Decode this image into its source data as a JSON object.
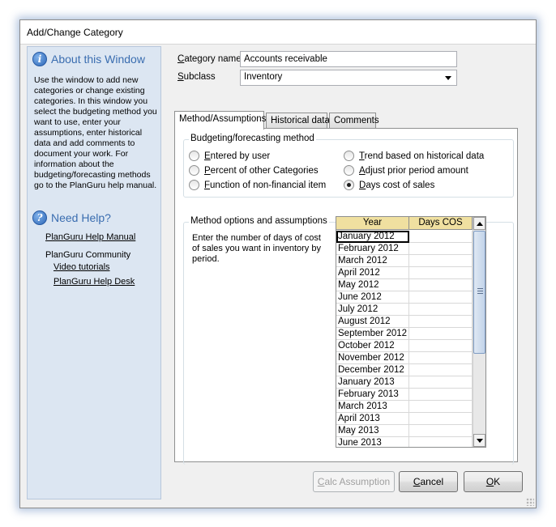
{
  "window": {
    "title": "Add/Change Category"
  },
  "side": {
    "about_heading": "About this Window",
    "about_body": "Use the window to add new categories or change existing categories.  In this window you select the budgeting method you want to use, enter your assumptions, enter historical data and add comments to document your work.  For information about the budgeting/forecasting methods go to the PlanGuru help manual.",
    "help_heading": "Need Help?",
    "help_manual_link": "PlanGuru Help Manual",
    "community_label": "PlanGuru Community",
    "video_link": "Video tutorials",
    "helpdesk_link": "PlanGuru Help Desk"
  },
  "form": {
    "category_label_prefix": "C",
    "category_label_rest": "ategory name",
    "category_value": "Accounts receivable",
    "subclass_label_prefix": "S",
    "subclass_label_rest": "ubclass",
    "subclass_value": "Inventory"
  },
  "tabs": [
    "Method/Assumptions",
    "Historical data",
    "Comments"
  ],
  "method_group": {
    "legend": "Budgeting/forecasting method",
    "options": [
      {
        "label_u": "E",
        "label_rest": "ntered by user",
        "checked": false
      },
      {
        "label_u": "P",
        "label_rest": "ercent of other Categories",
        "checked": false
      },
      {
        "label_u": "F",
        "label_rest": "unction of non-financial item",
        "checked": false
      },
      {
        "label_u": "T",
        "label_rest": "rend based on historical data",
        "checked": false
      },
      {
        "label_u": "A",
        "label_rest": "djust prior period amount",
        "checked": false
      },
      {
        "label_u": "D",
        "label_rest": "ays cost of sales",
        "checked": true
      }
    ]
  },
  "options_group": {
    "legend": "Method options and assumptions",
    "instructions": "Enter the number of days of cost of sales you want in inventory by period."
  },
  "grid": {
    "headers": [
      "Year",
      "Days COS"
    ],
    "rows": [
      "January  2012",
      "February  2012",
      "March  2012",
      "April  2012",
      "May  2012",
      "June  2012",
      "July  2012",
      "August  2012",
      "September  2012",
      "October  2012",
      "November  2012",
      "December  2012",
      "January  2013",
      "February  2013",
      "March  2013",
      "April  2013",
      "May  2013",
      "June  2013"
    ]
  },
  "buttons": {
    "calc_u": "C",
    "calc_rest": "alc Assumption",
    "cancel_u": "C",
    "cancel_rest": "ancel",
    "ok_u": "O",
    "ok_rest": "K"
  },
  "colors": {
    "side_panel": "#dce6f2",
    "heading_blue": "#3a6db0",
    "grid_header": "#f0e0a0",
    "scroll_thumb": "#c3d4ea"
  }
}
